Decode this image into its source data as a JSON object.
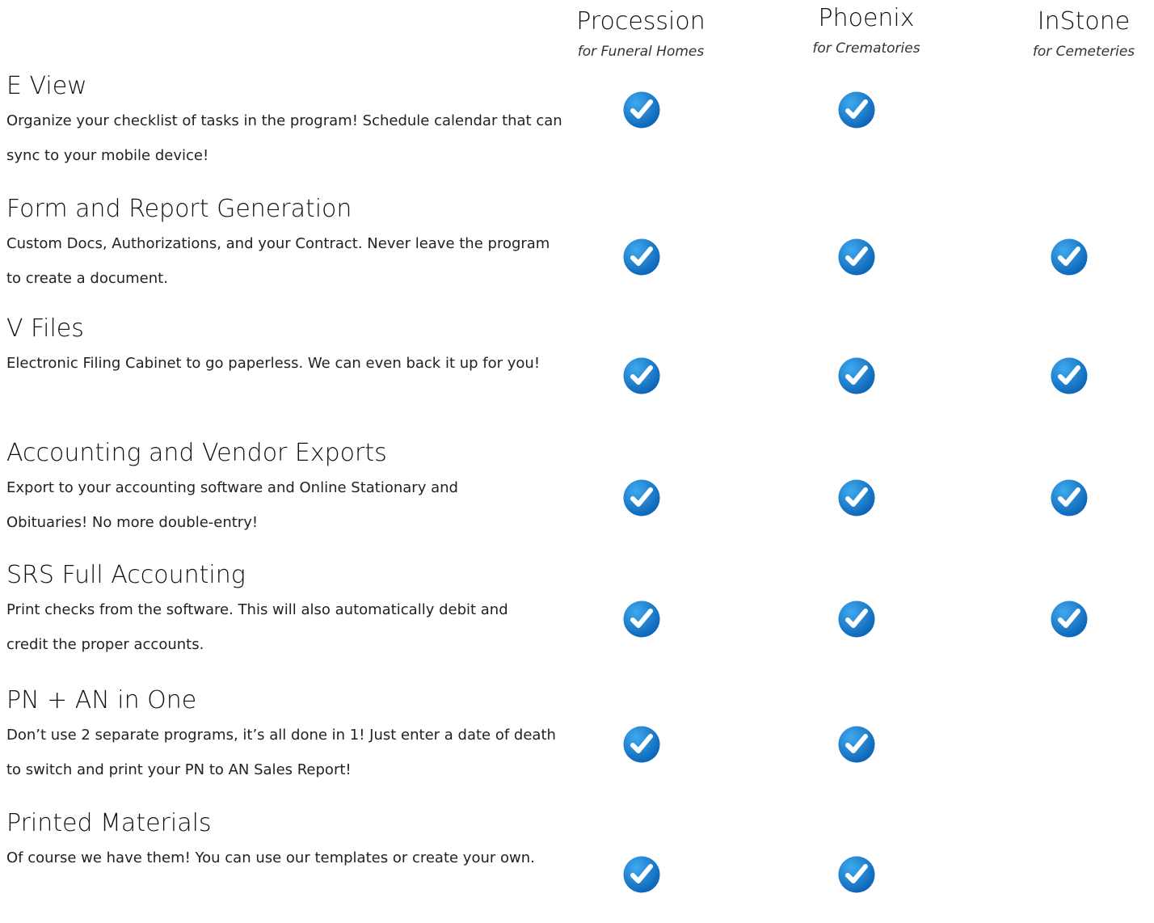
{
  "columns": [
    {
      "name": "Procession",
      "subtitle": "for Funeral Homes"
    },
    {
      "name": "Phoenix",
      "subtitle": "for Crematories"
    },
    {
      "name": "InStone",
      "subtitle": "for Cemeteries"
    }
  ],
  "features": [
    {
      "title": "E View",
      "description": "Organize your checklist of tasks in the program! Schedule calendar that can sync to your mobile device!",
      "checks": {
        "procession": true,
        "phoenix": true,
        "instone": false
      }
    },
    {
      "title": "Form and Report Generation",
      "description": "Custom Docs, Authorizations, and your Contract. Never leave the program to create a document.",
      "checks": {
        "procession": true,
        "phoenix": true,
        "instone": true
      }
    },
    {
      "title": "V Files",
      "description": "Electronic Filing Cabinet to go paperless. We can even back it up for you!",
      "checks": {
        "procession": true,
        "phoenix": true,
        "instone": true
      }
    },
    {
      "title": "Accounting and Vendor Exports",
      "description": "Export to your accounting software and Online Stationary and Obituaries! No more double-entry!",
      "checks": {
        "procession": true,
        "phoenix": true,
        "instone": true
      }
    },
    {
      "title": "SRS Full Accounting",
      "description": "Print checks from the software. This will also automatically debit and credit the proper accounts.",
      "checks": {
        "procession": true,
        "phoenix": true,
        "instone": true
      }
    },
    {
      "title": "PN + AN in One",
      "description": "Don’t use 2 separate programs, it’s all done in 1! Just enter a date of death to switch and print your  PN to AN Sales Report!",
      "checks": {
        "procession": true,
        "phoenix": true,
        "instone": false
      }
    },
    {
      "title": "Printed Materials",
      "description": "Of course we have them! You can use our templates or create your own.",
      "checks": {
        "procession": true,
        "phoenix": true,
        "instone": false
      }
    }
  ],
  "icons": {
    "check": "check-circle-icon"
  },
  "colors": {
    "check_light": "#3fa9ee",
    "check_dark": "#0b63b5",
    "check_mark": "#ffffff"
  }
}
